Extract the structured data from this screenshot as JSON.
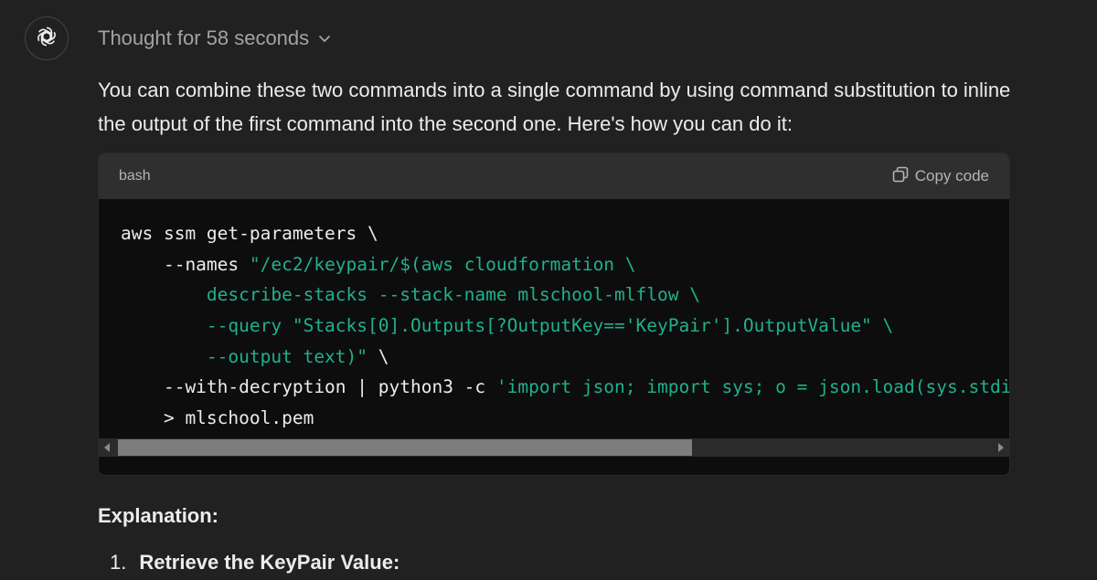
{
  "assistant": {
    "avatar_icon": "openai-logo-icon",
    "thought_label": "Thought for 58 seconds",
    "thought_toggle_icon": "chevron-down-icon"
  },
  "answer": {
    "intro": "You can combine these two commands into a single command by using command substitution to inline the output of the first command into the second one. Here's how you can do it:"
  },
  "code_block": {
    "language": "bash",
    "copy_label": "Copy code",
    "copy_icon": "copy-icon",
    "lines": [
      [
        {
          "t": "aws ssm get-parameters \\",
          "c": "plain"
        }
      ],
      [
        {
          "t": "    --names ",
          "c": "plain"
        },
        {
          "t": "\"/ec2/keypair/$(aws cloudformation \\",
          "c": "str"
        }
      ],
      [
        {
          "t": "        describe-stacks --stack-name mlschool-mlflow \\",
          "c": "str"
        }
      ],
      [
        {
          "t": "        --query \"Stacks[0].Outputs[?OutputKey=='KeyPair'].OutputValue\" \\",
          "c": "str"
        }
      ],
      [
        {
          "t": "        --output text)\"",
          "c": "str"
        },
        {
          "t": " \\",
          "c": "plain"
        }
      ],
      [
        {
          "t": "    --with-decryption | python3 -c ",
          "c": "plain"
        },
        {
          "t": "'import json; import sys; o = json.load(sys.stdi",
          "c": "str"
        }
      ],
      [
        {
          "t": "    > mlschool.pem",
          "c": "plain"
        }
      ]
    ]
  },
  "explanation": {
    "heading": "Explanation:",
    "items": [
      {
        "number": "1.",
        "text": "Retrieve the KeyPair Value:"
      }
    ]
  },
  "colors": {
    "background": "#212121",
    "code_background": "#0d0d0d",
    "code_header": "#2f2f2f",
    "string_token": "#20b08c",
    "muted_text": "#a3a3a3"
  }
}
